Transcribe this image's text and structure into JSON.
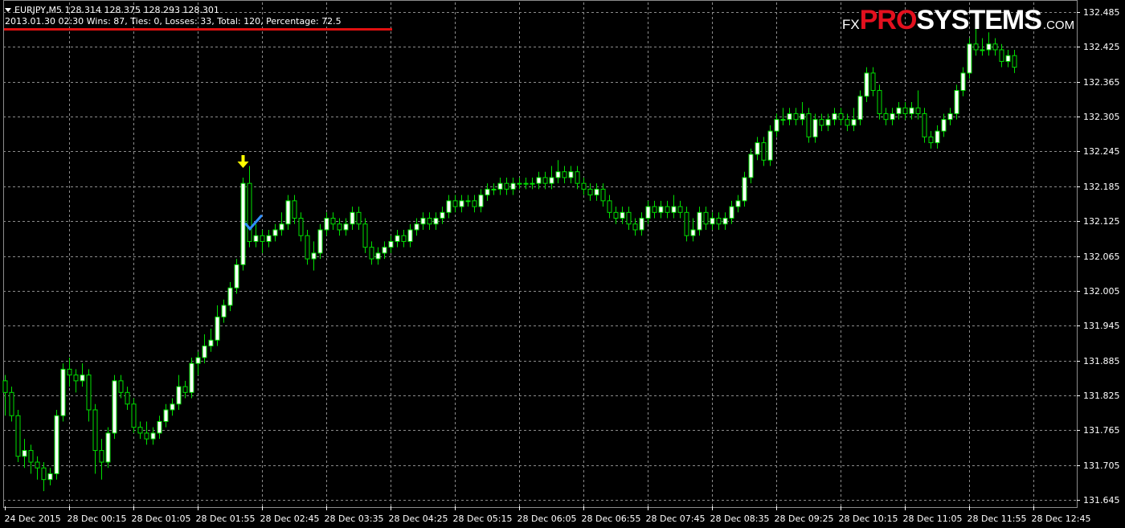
{
  "header": {
    "symbol_line": "EURJPY,M5  128.314 128.375 128.293 128.301",
    "stats_line": "2013.01.30 02:30 Wins: 87, Ties: 0, Losses: 33, Total: 120, Percentage: 72.5",
    "underline_color": "#e01010"
  },
  "logo": {
    "fx": "FX",
    "pro": "PRO",
    "systems": "SYSTEMS",
    "com": ".COM",
    "pro_color": "#e3101e"
  },
  "colors": {
    "background": "#000000",
    "grid": "#8c8c8c",
    "candle": "#00e000",
    "bull_fill": "#ffffff",
    "bear_fill": "#000000",
    "down_arrow": "#ffff00",
    "checkmark": "#2f8fff"
  },
  "signals": [
    {
      "type": "down-arrow",
      "at_bar_time": "28 Dec 02:30",
      "icon": "arrow-down-icon"
    },
    {
      "type": "checkmark",
      "at_bar_time": "28 Dec 02:40",
      "icon": "checkmark-icon"
    }
  ],
  "chart_data": {
    "type": "candlestick",
    "title": "",
    "xlabel": "",
    "ylabel": "",
    "grid": true,
    "ylim": [
      131.645,
      132.485
    ],
    "y_ticks": [
      "132.485",
      "132.425",
      "132.365",
      "132.305",
      "132.245",
      "132.185",
      "132.125",
      "132.065",
      "132.005",
      "131.945",
      "131.885",
      "131.825",
      "131.765",
      "131.705",
      "131.645"
    ],
    "x_ticks": [
      {
        "label": "24 Dec 2015",
        "bar": 0
      },
      {
        "label": "28 Dec 00:15",
        "bar": 10
      },
      {
        "label": "28 Dec 01:05",
        "bar": 20
      },
      {
        "label": "28 Dec 01:55",
        "bar": 30
      },
      {
        "label": "28 Dec 02:45",
        "bar": 40
      },
      {
        "label": "28 Dec 03:35",
        "bar": 50
      },
      {
        "label": "28 Dec 04:25",
        "bar": 60
      },
      {
        "label": "28 Dec 05:15",
        "bar": 70
      },
      {
        "label": "28 Dec 06:05",
        "bar": 80
      },
      {
        "label": "28 Dec 06:55",
        "bar": 90
      },
      {
        "label": "28 Dec 07:45",
        "bar": 100
      },
      {
        "label": "28 Dec 08:35",
        "bar": 110
      },
      {
        "label": "28 Dec 09:25",
        "bar": 120
      },
      {
        "label": "28 Dec 10:15",
        "bar": 130
      },
      {
        "label": "28 Dec 11:05",
        "bar": 140
      },
      {
        "label": "28 Dec 11:55",
        "bar": 150
      },
      {
        "label": "28 Dec 12:45",
        "bar": 160
      }
    ],
    "last_price_label": "131.645",
    "candles": [
      [
        131.85,
        131.83,
        131.86,
        131.79
      ],
      [
        131.83,
        131.79,
        131.84,
        131.78
      ],
      [
        131.79,
        131.72,
        131.8,
        131.71
      ],
      [
        131.72,
        131.73,
        131.75,
        131.7
      ],
      [
        131.73,
        131.71,
        131.74,
        131.69
      ],
      [
        131.71,
        131.7,
        131.72,
        131.68
      ],
      [
        131.7,
        131.68,
        131.71,
        131.66
      ],
      [
        131.68,
        131.69,
        131.7,
        131.67
      ],
      [
        131.69,
        131.79,
        131.8,
        131.68
      ],
      [
        131.79,
        131.87,
        131.88,
        131.78
      ],
      [
        131.87,
        131.86,
        131.89,
        131.84
      ],
      [
        131.86,
        131.85,
        131.87,
        131.83
      ],
      [
        131.85,
        131.86,
        131.88,
        131.84
      ],
      [
        131.86,
        131.8,
        131.87,
        131.78
      ],
      [
        131.8,
        131.73,
        131.81,
        131.69
      ],
      [
        131.73,
        131.71,
        131.75,
        131.68
      ],
      [
        131.71,
        131.76,
        131.77,
        131.7
      ],
      [
        131.76,
        131.85,
        131.86,
        131.75
      ],
      [
        131.85,
        131.83,
        131.86,
        131.82
      ],
      [
        131.83,
        131.81,
        131.84,
        131.8
      ],
      [
        131.81,
        131.77,
        131.82,
        131.76
      ],
      [
        131.77,
        131.76,
        131.78,
        131.75
      ],
      [
        131.76,
        131.75,
        131.78,
        131.74
      ],
      [
        131.75,
        131.76,
        131.77,
        131.74
      ],
      [
        131.76,
        131.78,
        131.79,
        131.75
      ],
      [
        131.78,
        131.8,
        131.81,
        131.77
      ],
      [
        131.8,
        131.81,
        131.82,
        131.79
      ],
      [
        131.81,
        131.84,
        131.86,
        131.8
      ],
      [
        131.84,
        131.83,
        131.85,
        131.82
      ],
      [
        131.83,
        131.88,
        131.89,
        131.82
      ],
      [
        131.88,
        131.89,
        131.9,
        131.86
      ],
      [
        131.89,
        131.91,
        131.93,
        131.88
      ],
      [
        131.91,
        131.92,
        131.94,
        131.9
      ],
      [
        131.92,
        131.96,
        131.98,
        131.91
      ],
      [
        131.96,
        131.98,
        131.99,
        131.95
      ],
      [
        131.98,
        132.01,
        132.02,
        131.97
      ],
      [
        132.01,
        132.05,
        132.06,
        132.0
      ],
      [
        132.05,
        132.19,
        132.2,
        132.04
      ],
      [
        132.19,
        132.09,
        132.22,
        132.08
      ],
      [
        132.09,
        132.1,
        132.12,
        132.08
      ],
      [
        132.1,
        132.09,
        132.11,
        132.07
      ],
      [
        132.09,
        132.1,
        132.11,
        132.08
      ],
      [
        132.1,
        132.11,
        132.12,
        132.09
      ],
      [
        132.11,
        132.12,
        132.14,
        132.1
      ],
      [
        132.12,
        132.16,
        132.17,
        132.11
      ],
      [
        132.16,
        132.13,
        132.17,
        132.12
      ],
      [
        132.13,
        132.1,
        132.14,
        132.09
      ],
      [
        132.1,
        132.06,
        132.11,
        132.05
      ],
      [
        132.06,
        132.07,
        132.09,
        132.04
      ],
      [
        132.07,
        132.11,
        132.12,
        132.06
      ],
      [
        132.11,
        132.13,
        132.14,
        132.1
      ],
      [
        132.13,
        132.12,
        132.14,
        132.11
      ],
      [
        132.12,
        132.11,
        132.13,
        132.1
      ],
      [
        132.11,
        132.12,
        132.13,
        132.1
      ],
      [
        132.12,
        132.14,
        132.15,
        132.11
      ],
      [
        132.14,
        132.12,
        132.15,
        132.11
      ],
      [
        132.12,
        132.08,
        132.13,
        132.07
      ],
      [
        132.08,
        132.06,
        132.09,
        132.05
      ],
      [
        132.06,
        132.07,
        132.08,
        132.05
      ],
      [
        132.07,
        132.08,
        132.09,
        132.06
      ],
      [
        132.08,
        132.09,
        132.1,
        132.07
      ],
      [
        132.09,
        132.1,
        132.11,
        132.08
      ],
      [
        132.1,
        132.09,
        132.11,
        132.08
      ],
      [
        132.09,
        132.11,
        132.12,
        132.08
      ],
      [
        132.11,
        132.12,
        132.13,
        132.1
      ],
      [
        132.12,
        132.13,
        132.14,
        132.11
      ],
      [
        132.13,
        132.12,
        132.14,
        132.11
      ],
      [
        132.12,
        132.13,
        132.14,
        132.11
      ],
      [
        132.13,
        132.14,
        132.15,
        132.12
      ],
      [
        132.14,
        132.16,
        132.17,
        132.13
      ],
      [
        132.16,
        132.15,
        132.17,
        132.14
      ],
      [
        132.15,
        132.16,
        132.17,
        132.14
      ],
      [
        132.16,
        132.16,
        132.17,
        132.15
      ],
      [
        132.16,
        132.15,
        132.17,
        132.14
      ],
      [
        132.15,
        132.17,
        132.18,
        132.14
      ],
      [
        132.17,
        132.18,
        132.19,
        132.16
      ],
      [
        132.18,
        132.18,
        132.19,
        132.17
      ],
      [
        132.18,
        132.19,
        132.2,
        132.17
      ],
      [
        132.19,
        132.18,
        132.2,
        132.17
      ],
      [
        132.18,
        132.19,
        132.2,
        132.17
      ],
      [
        132.19,
        132.19,
        132.2,
        132.18
      ],
      [
        132.19,
        132.19,
        132.2,
        132.18
      ],
      [
        132.19,
        132.19,
        132.2,
        132.18
      ],
      [
        132.19,
        132.2,
        132.21,
        132.18
      ],
      [
        132.2,
        132.19,
        132.21,
        132.18
      ],
      [
        132.19,
        132.2,
        132.22,
        132.18
      ],
      [
        132.2,
        132.21,
        132.23,
        132.19
      ],
      [
        132.21,
        132.2,
        132.22,
        132.19
      ],
      [
        132.2,
        132.21,
        132.22,
        132.19
      ],
      [
        132.21,
        132.19,
        132.22,
        132.18
      ],
      [
        132.19,
        132.18,
        132.2,
        132.17
      ],
      [
        132.18,
        132.17,
        132.19,
        132.16
      ],
      [
        132.17,
        132.18,
        132.19,
        132.16
      ],
      [
        132.18,
        132.16,
        132.19,
        132.15
      ],
      [
        132.16,
        132.14,
        132.17,
        132.13
      ],
      [
        132.14,
        132.13,
        132.15,
        132.12
      ],
      [
        132.13,
        132.14,
        132.15,
        132.12
      ],
      [
        132.14,
        132.12,
        132.15,
        132.11
      ],
      [
        132.12,
        132.11,
        132.13,
        132.1
      ],
      [
        132.11,
        132.13,
        132.14,
        132.1
      ],
      [
        132.13,
        132.15,
        132.16,
        132.12
      ],
      [
        132.15,
        132.14,
        132.16,
        132.13
      ],
      [
        132.14,
        132.15,
        132.16,
        132.13
      ],
      [
        132.15,
        132.14,
        132.16,
        132.13
      ],
      [
        132.14,
        132.15,
        132.17,
        132.13
      ],
      [
        132.15,
        132.14,
        132.16,
        132.13
      ],
      [
        132.14,
        132.1,
        132.15,
        132.09
      ],
      [
        132.1,
        132.11,
        132.13,
        132.09
      ],
      [
        132.11,
        132.14,
        132.15,
        132.1
      ],
      [
        132.14,
        132.12,
        132.15,
        132.11
      ],
      [
        132.12,
        132.13,
        132.14,
        132.11
      ],
      [
        132.13,
        132.12,
        132.14,
        132.11
      ],
      [
        132.12,
        132.13,
        132.14,
        132.11
      ],
      [
        132.13,
        132.15,
        132.16,
        132.12
      ],
      [
        132.15,
        132.16,
        132.17,
        132.14
      ],
      [
        132.16,
        132.2,
        132.21,
        132.15
      ],
      [
        132.2,
        132.24,
        132.25,
        132.19
      ],
      [
        132.24,
        132.26,
        132.27,
        132.23
      ],
      [
        132.26,
        132.23,
        132.27,
        132.22
      ],
      [
        132.23,
        132.28,
        132.29,
        132.22
      ],
      [
        132.28,
        132.3,
        132.31,
        132.27
      ],
      [
        132.3,
        132.3,
        132.32,
        132.29
      ],
      [
        132.3,
        132.31,
        132.32,
        132.29
      ],
      [
        132.31,
        132.3,
        132.32,
        132.29
      ],
      [
        132.3,
        132.31,
        132.33,
        132.29
      ],
      [
        132.31,
        132.27,
        132.32,
        132.26
      ],
      [
        132.27,
        132.3,
        132.31,
        132.26
      ],
      [
        132.3,
        132.29,
        132.31,
        132.28
      ],
      [
        132.29,
        132.3,
        132.31,
        132.28
      ],
      [
        132.3,
        132.31,
        132.32,
        132.29
      ],
      [
        132.31,
        132.3,
        132.32,
        132.29
      ],
      [
        132.3,
        132.29,
        132.31,
        132.28
      ],
      [
        132.29,
        132.3,
        132.32,
        132.28
      ],
      [
        132.3,
        132.34,
        132.35,
        132.29
      ],
      [
        132.34,
        132.38,
        132.39,
        132.33
      ],
      [
        132.38,
        132.35,
        132.39,
        132.34
      ],
      [
        132.35,
        132.31,
        132.36,
        132.3
      ],
      [
        132.31,
        132.3,
        132.32,
        132.29
      ],
      [
        132.3,
        132.31,
        132.32,
        132.29
      ],
      [
        132.31,
        132.32,
        132.33,
        132.3
      ],
      [
        132.32,
        132.31,
        132.33,
        132.3
      ],
      [
        132.31,
        132.32,
        132.33,
        132.3
      ],
      [
        132.32,
        132.31,
        132.35,
        132.3
      ],
      [
        132.31,
        132.27,
        132.32,
        132.26
      ],
      [
        132.27,
        132.26,
        132.28,
        132.25
      ],
      [
        132.26,
        132.28,
        132.29,
        132.25
      ],
      [
        132.28,
        132.3,
        132.31,
        132.27
      ],
      [
        132.3,
        132.31,
        132.32,
        132.29
      ],
      [
        132.31,
        132.35,
        132.36,
        132.3
      ],
      [
        132.35,
        132.38,
        132.39,
        132.34
      ],
      [
        132.38,
        132.43,
        132.44,
        132.37
      ],
      [
        132.43,
        132.42,
        132.46,
        132.41
      ],
      [
        132.42,
        132.42,
        132.44,
        132.41
      ],
      [
        132.42,
        132.43,
        132.45,
        132.41
      ],
      [
        132.43,
        132.42,
        132.44,
        132.41
      ],
      [
        132.42,
        132.4,
        132.43,
        132.39
      ],
      [
        132.4,
        132.41,
        132.42,
        132.39
      ],
      [
        132.41,
        132.39,
        132.42,
        132.38
      ]
    ]
  }
}
